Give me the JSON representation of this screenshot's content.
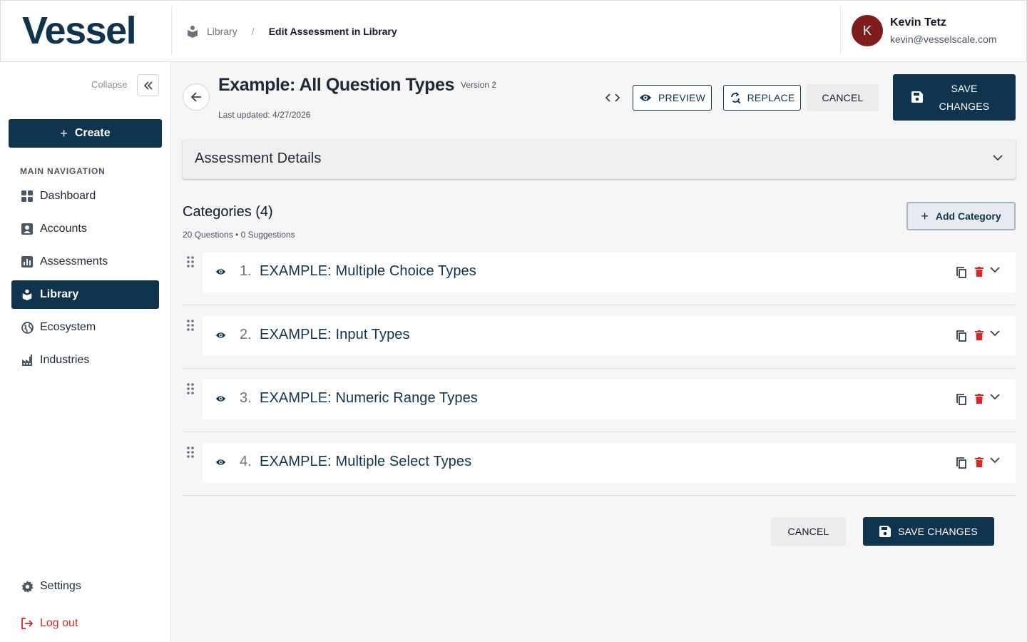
{
  "header": {
    "logo": "Vessel",
    "breadcrumb": {
      "parent": "Library",
      "separator": "/",
      "current": "Edit Assessment in Library"
    },
    "user": {
      "initial": "K",
      "name": "Kevin Tetz",
      "email": "kevin@vesselscale.com",
      "avatar_color": "#7f1d1d"
    }
  },
  "sidebar": {
    "collapse_label": "Collapse",
    "create_label": "Create",
    "nav_heading": "MAIN NAVIGATION",
    "items": [
      {
        "label": "Dashboard",
        "icon": "dashboard-icon"
      },
      {
        "label": "Accounts",
        "icon": "account-box-icon"
      },
      {
        "label": "Assessments",
        "icon": "bar-chart-icon"
      },
      {
        "label": "Library",
        "icon": "book-icon",
        "active": true
      },
      {
        "label": "Ecosystem",
        "icon": "globe-icon"
      },
      {
        "label": "Industries",
        "icon": "factory-icon"
      }
    ],
    "settings_label": "Settings",
    "logout_label": "Log out"
  },
  "assessment": {
    "title": "Example: All Question Types",
    "version": "Version 2",
    "last_updated": "Last updated: 4/27/2026"
  },
  "toolbar": {
    "preview_label": "PREVIEW",
    "replace_label": "REPLACE",
    "cancel_label": "CANCEL",
    "save_line1": "SAVE",
    "save_line2": "CHANGES"
  },
  "details": {
    "title": "Assessment Details"
  },
  "categories": {
    "title": "Categories (4)",
    "meta": "20 Questions • 0 Suggestions",
    "add_label": "Add Category",
    "items": [
      {
        "num": "1.",
        "name": "EXAMPLE: Multiple Choice Types"
      },
      {
        "num": "2.",
        "name": "EXAMPLE: Input Types"
      },
      {
        "num": "3.",
        "name": "EXAMPLE: Numeric Range Types"
      },
      {
        "num": "4.",
        "name": "EXAMPLE: Multiple Select Types"
      }
    ]
  },
  "footer": {
    "cancel_label": "CANCEL",
    "save_label": "SAVE CHANGES"
  },
  "colors": {
    "brand": "#10344d",
    "delete": "#dc2626",
    "logout": "#dc2626"
  }
}
